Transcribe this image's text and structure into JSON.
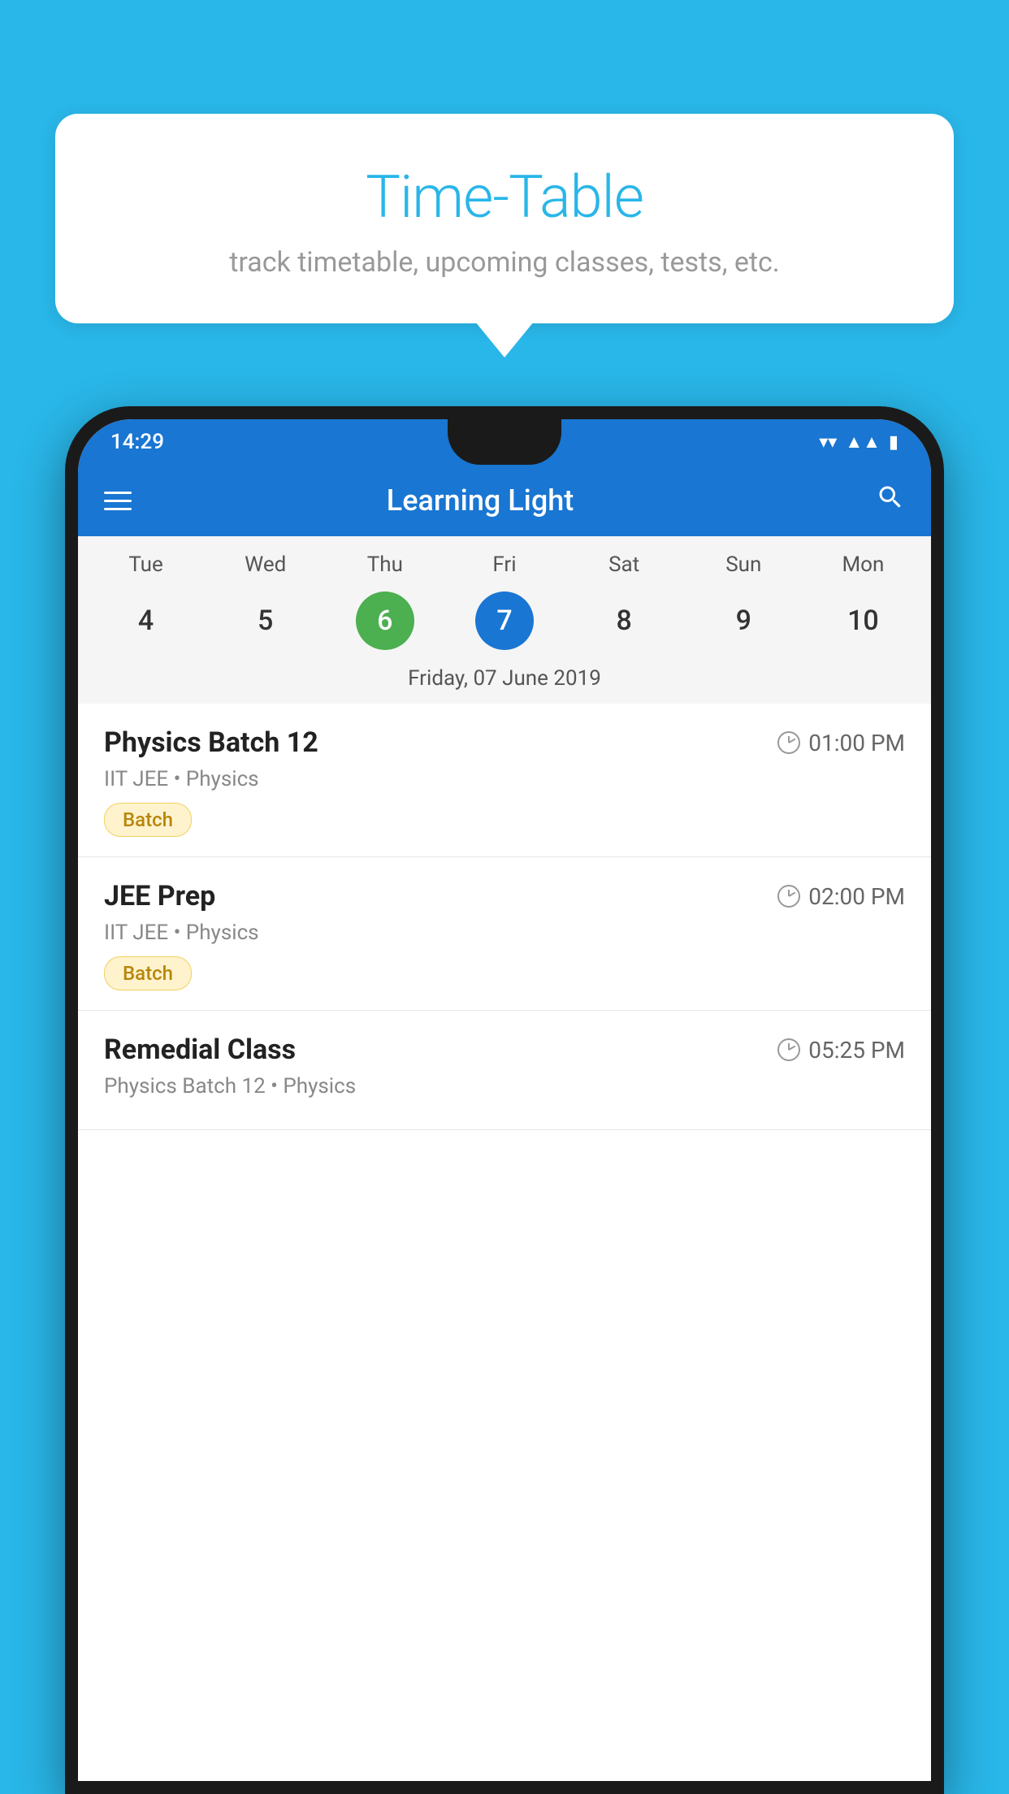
{
  "background_color": "#29b6e8",
  "tooltip": {
    "title": "Time-Table",
    "subtitle": "track timetable, upcoming classes, tests, etc."
  },
  "phone": {
    "status_bar": {
      "time": "14:29"
    },
    "app_bar": {
      "title": "Learning Light"
    },
    "calendar": {
      "days": [
        {
          "name": "Tue",
          "num": "4"
        },
        {
          "name": "Wed",
          "num": "5"
        },
        {
          "name": "Thu",
          "num": "6",
          "state": "today"
        },
        {
          "name": "Fri",
          "num": "7",
          "state": "selected"
        },
        {
          "name": "Sat",
          "num": "8"
        },
        {
          "name": "Sun",
          "num": "9"
        },
        {
          "name": "Mon",
          "num": "10"
        }
      ],
      "selected_date_label": "Friday, 07 June 2019"
    },
    "schedule": [
      {
        "name": "Physics Batch 12",
        "time": "01:00 PM",
        "meta": "IIT JEE • Physics",
        "badge": "Batch"
      },
      {
        "name": "JEE Prep",
        "time": "02:00 PM",
        "meta": "IIT JEE • Physics",
        "badge": "Batch"
      },
      {
        "name": "Remedial Class",
        "time": "05:25 PM",
        "meta": "Physics Batch 12 • Physics",
        "badge": ""
      }
    ]
  }
}
